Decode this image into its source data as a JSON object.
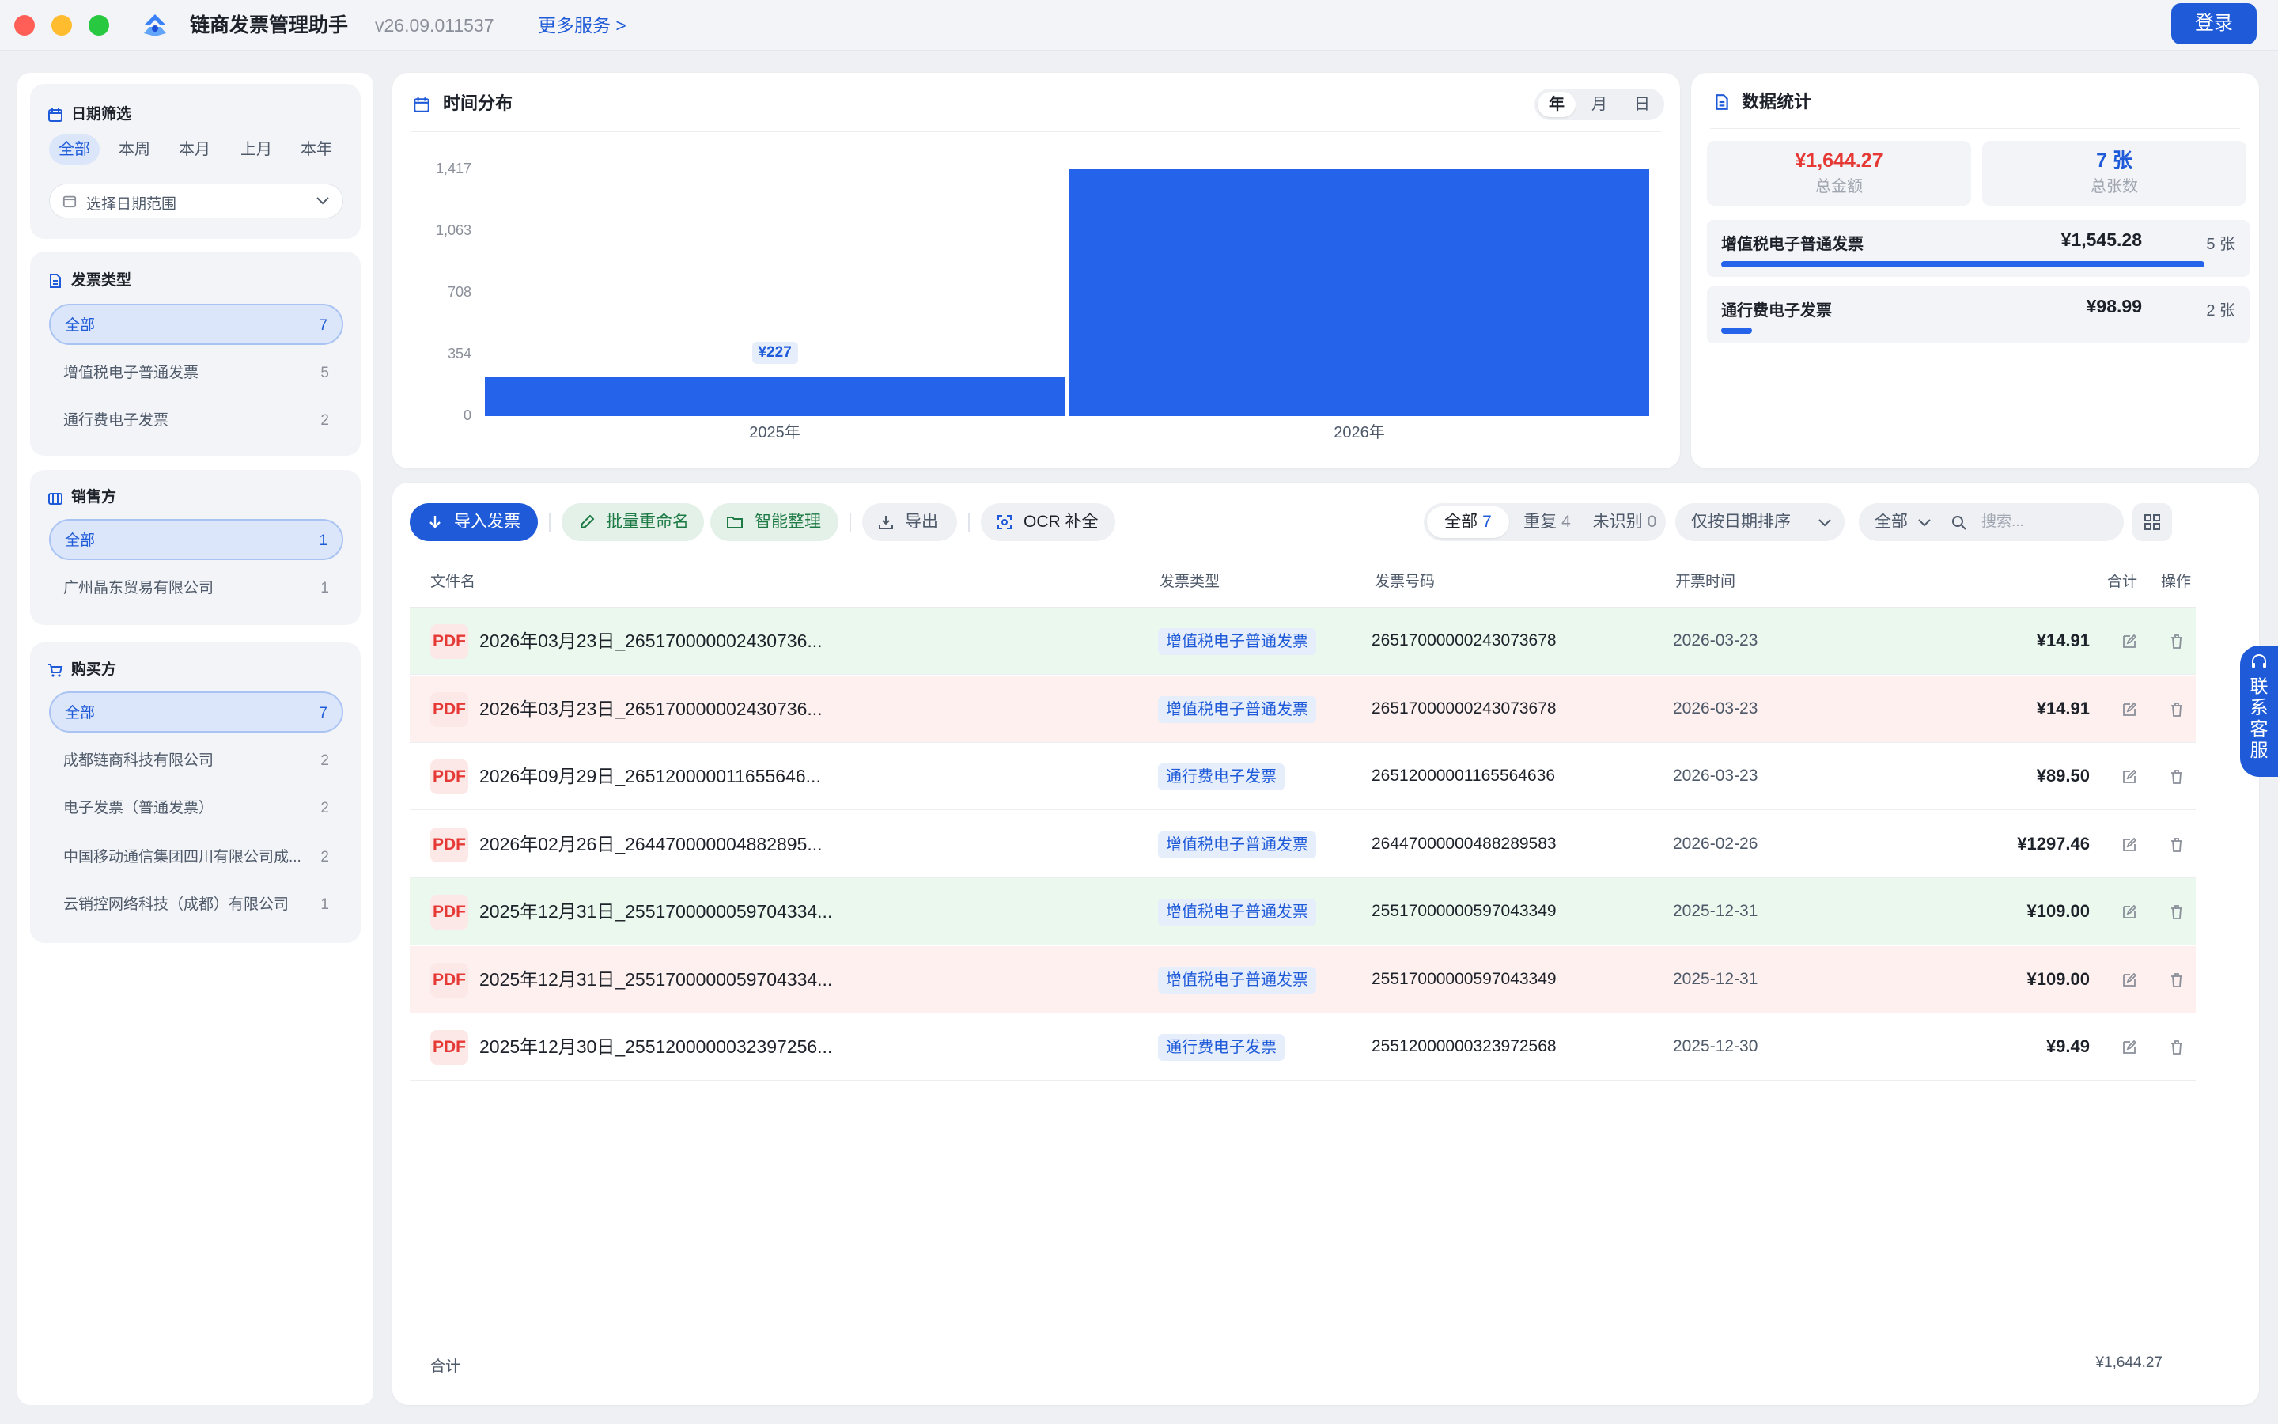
{
  "app": {
    "title": "链商发票管理助手",
    "version": "v26.09.011537",
    "more_services": "更多服务 >",
    "login": "登录"
  },
  "sidebar": {
    "date_filter": {
      "title": "日期筛选",
      "chips": [
        "全部",
        "本周",
        "本月",
        "上月",
        "本年"
      ],
      "selected": "全部",
      "range_placeholder": "选择日期范围"
    },
    "invoice_type": {
      "title": "发票类型",
      "items": [
        {
          "label": "全部",
          "count": "7"
        },
        {
          "label": "增值税电子普通发票",
          "count": "5"
        },
        {
          "label": "通行费电子发票",
          "count": "2"
        }
      ]
    },
    "seller": {
      "title": "销售方",
      "items": [
        {
          "label": "全部",
          "count": "1"
        },
        {
          "label": "广州晶东贸易有限公司",
          "count": "1"
        }
      ]
    },
    "buyer": {
      "title": "购买方",
      "items": [
        {
          "label": "全部",
          "count": "7"
        },
        {
          "label": "成都链商科技有限公司",
          "count": "2"
        },
        {
          "label": "电子发票（普通发票）",
          "count": "2"
        },
        {
          "label": "中国移动通信集团四川有限公司成...",
          "count": "2"
        },
        {
          "label": "云销控网络科技（成都）有限公司",
          "count": "1"
        }
      ]
    }
  },
  "time_panel": {
    "title": "时间分布",
    "granularity": [
      "年",
      "月",
      "日"
    ],
    "selected": "年"
  },
  "chart_data": {
    "type": "bar",
    "categories": [
      "2025年",
      "2026年"
    ],
    "values": [
      227,
      1417
    ],
    "ylim": [
      0,
      1417
    ],
    "yticks": [
      "0",
      "354",
      "708",
      "1,063",
      "1,417"
    ],
    "data_labels": [
      "¥227",
      ""
    ],
    "grid": false
  },
  "stats": {
    "title": "数据统计",
    "total_amount": "¥1,644.27",
    "total_amount_label": "总金额",
    "total_count": "7 张",
    "total_count_label": "总张数",
    "types": [
      {
        "name": "增值税电子普通发票",
        "amount": "¥1,545.28",
        "count": "5 张",
        "share": 0.94
      },
      {
        "name": "通行费电子发票",
        "amount": "¥98.99",
        "count": "2 张",
        "share": 0.06
      }
    ]
  },
  "toolbar": {
    "import": "导入发票",
    "batch_rename": "批量重命名",
    "smart_organize": "智能整理",
    "export": "导出",
    "ocr": "OCR 补全",
    "tabs": [
      {
        "label": "全部",
        "count": "7"
      },
      {
        "label": "重复",
        "count": "4"
      },
      {
        "label": "未识别",
        "count": "0"
      }
    ],
    "sort": "仅按日期排序",
    "scope": "全部",
    "search_placeholder": "搜索..."
  },
  "table": {
    "headers": {
      "filename": "文件名",
      "type": "发票类型",
      "number": "发票号码",
      "date": "开票时间",
      "total": "合计",
      "actions": "操作"
    },
    "rows": [
      {
        "icon": "PDF",
        "filename": "2026年03月23日_265170000002430736...",
        "type": "增值税电子普通发票",
        "number": "26517000000243073678",
        "date": "2026-03-23",
        "amount": "¥14.91",
        "status": "green"
      },
      {
        "icon": "PDF",
        "filename": "2026年03月23日_265170000002430736...",
        "type": "增值税电子普通发票",
        "number": "26517000000243073678",
        "date": "2026-03-23",
        "amount": "¥14.91",
        "status": "red"
      },
      {
        "icon": "PDF",
        "filename": "2026年09月29日_265120000011655646...",
        "type": "通行费电子发票",
        "number": "26512000001165564636",
        "date": "2026-03-23",
        "amount": "¥89.50",
        "status": "none"
      },
      {
        "icon": "PDF",
        "filename": "2026年02月26日_264470000004882895...",
        "type": "增值税电子普通发票",
        "number": "26447000000488289583",
        "date": "2026-02-26",
        "amount": "¥1297.46",
        "status": "none"
      },
      {
        "icon": "PDF",
        "filename": "2025年12月31日_2551700000059704334...",
        "type": "增值税电子普通发票",
        "number": "25517000000597043349",
        "date": "2025-12-31",
        "amount": "¥109.00",
        "status": "green"
      },
      {
        "icon": "PDF",
        "filename": "2025年12月31日_2551700000059704334...",
        "type": "增值税电子普通发票",
        "number": "25517000000597043349",
        "date": "2025-12-31",
        "amount": "¥109.00",
        "status": "red"
      },
      {
        "icon": "PDF",
        "filename": "2025年12月30日_2551200000032397256...",
        "type": "通行费电子发票",
        "number": "25512000000323972568",
        "date": "2025-12-30",
        "amount": "¥9.49",
        "status": "none"
      }
    ],
    "footer_label": "合计",
    "footer_total": "¥1,644.27"
  },
  "support": {
    "label": "联系客服"
  },
  "colors": {
    "accent": "#1f5bd8",
    "bar": "#2563eb",
    "row_green": "#eaf8ee",
    "row_red": "#fdf0ee",
    "danger": "#e53935"
  }
}
